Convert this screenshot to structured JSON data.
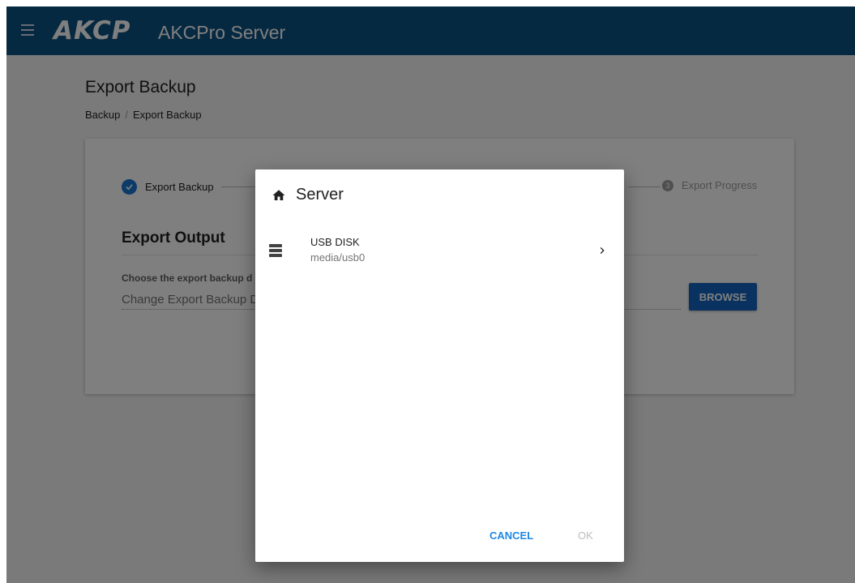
{
  "header": {
    "logo": "AKCP",
    "app_title": "AKCPro Server"
  },
  "page": {
    "title": "Export Backup",
    "breadcrumb": [
      "Backup",
      "Export Backup"
    ]
  },
  "stepper": {
    "step1": {
      "label": "Export Backup",
      "status": "done"
    },
    "step3": {
      "number": "3",
      "label": "Export Progress"
    }
  },
  "export_output": {
    "title": "Export Output",
    "field_label": "Choose the export backup d",
    "field_placeholder": "Change Export Backup D",
    "browse_label": "BROWSE"
  },
  "dialog": {
    "title": "Server",
    "items": [
      {
        "name": "USB DISK",
        "path": "media/usb0"
      }
    ],
    "cancel_label": "CANCEL",
    "ok_label": "OK"
  },
  "colors": {
    "header": "#0c5285",
    "accent": "#1976d2",
    "button": "#1565c0"
  }
}
